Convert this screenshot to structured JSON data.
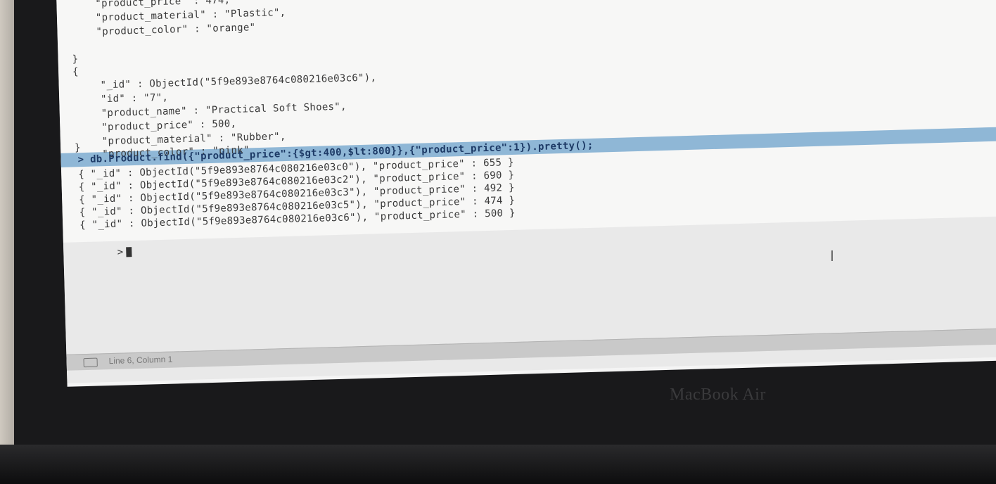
{
  "terminal": {
    "lines_top": [
      "    \"product_price\" : 474,",
      "    \"product_material\" : \"Plastic\",",
      "    \"product_color\" : \"orange\"",
      "",
      "}",
      "{",
      "",
      "    \"_id\" : ObjectId(\"5f9e893e8764c080216e03c6\"),",
      "    \"id\" : \"7\",",
      "    \"product_name\" : \"Practical Soft Shoes\",",
      "    \"product_price\" : 500,",
      "    \"product_material\" : \"Rubber\",",
      "    \"product_color\" : \"pink\"",
      "",
      "}"
    ],
    "command": "> db.Product.find({\"product_price\":{$gt:400,$lt:800}},{\"product_price\":1}).pretty();",
    "results": [
      "{ \"_id\" : ObjectId(\"5f9e893e8764c080216e03c0\"), \"product_price\" : 655 }",
      "{ \"_id\" : ObjectId(\"5f9e893e8764c080216e03c2\"), \"product_price\" : 690 }",
      "{ \"_id\" : ObjectId(\"5f9e893e8764c080216e03c3\"), \"product_price\" : 492 }",
      "{ \"_id\" : ObjectId(\"5f9e893e8764c080216e03c5\"), \"product_price\" : 474 }",
      "{ \"_id\" : ObjectId(\"5f9e893e8764c080216e03c6\"), \"product_price\" : 500 }"
    ],
    "prompt": ">"
  },
  "status_bar": {
    "position_text": "Line 6, Column 1"
  },
  "device": {
    "brand": "MacBook Air"
  },
  "colors": {
    "highlight": "#8fb7d6",
    "command_text": "#1d3a66"
  }
}
